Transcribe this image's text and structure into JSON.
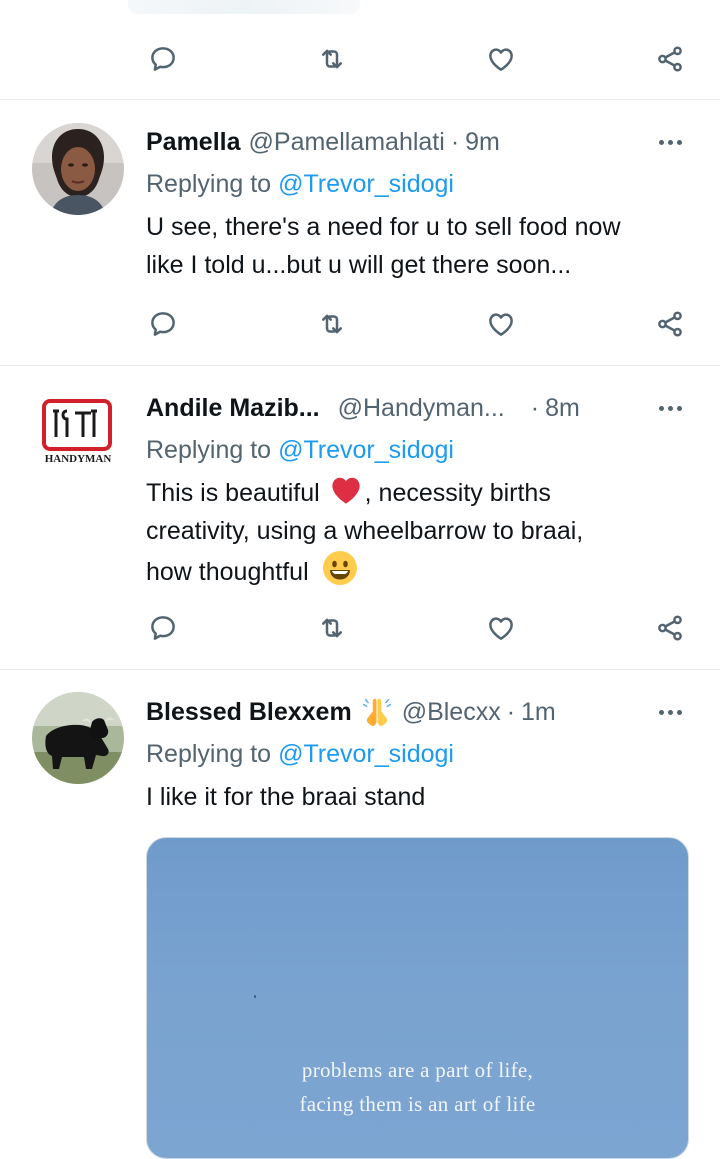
{
  "tweets": [
    {
      "name": "Pamella",
      "handle": "@Pamellamahlati",
      "time": "9m",
      "replying_prefix": "Replying to",
      "replying_to": "@Trevor_sidogi",
      "lines": [
        "U see, there's a  need for u to sell food now",
        "like I told u...but u will get there soon..."
      ]
    },
    {
      "name": "Andile Mazib...",
      "handle": "@Handyman...",
      "time": "8m",
      "replying_prefix": "Replying to",
      "replying_to": "@Trevor_sidogi",
      "line1_before": "This is beautiful",
      "line1_after": ", necessity births",
      "line2": "creativity, using a wheelbarrow to braai,",
      "line3": "how thoughtful",
      "avatar_logo_text": "HANDYMAN"
    },
    {
      "name": "Blessed Blexxem",
      "handle": "@Blecxx",
      "time": "1m",
      "replying_prefix": "Replying to",
      "replying_to": "@Trevor_sidogi",
      "text": "I like it for the braai stand",
      "media_quote": [
        "problems are a part of life,",
        "facing them is an art of life"
      ]
    }
  ],
  "icons": {
    "reply": "reply-icon",
    "retweet": "retweet-icon",
    "like": "like-icon",
    "share": "share-icon",
    "more": "more-icon"
  },
  "colors": {
    "link": "#1d9bf0",
    "secondary": "#536471",
    "divider": "#e6ecf0"
  }
}
